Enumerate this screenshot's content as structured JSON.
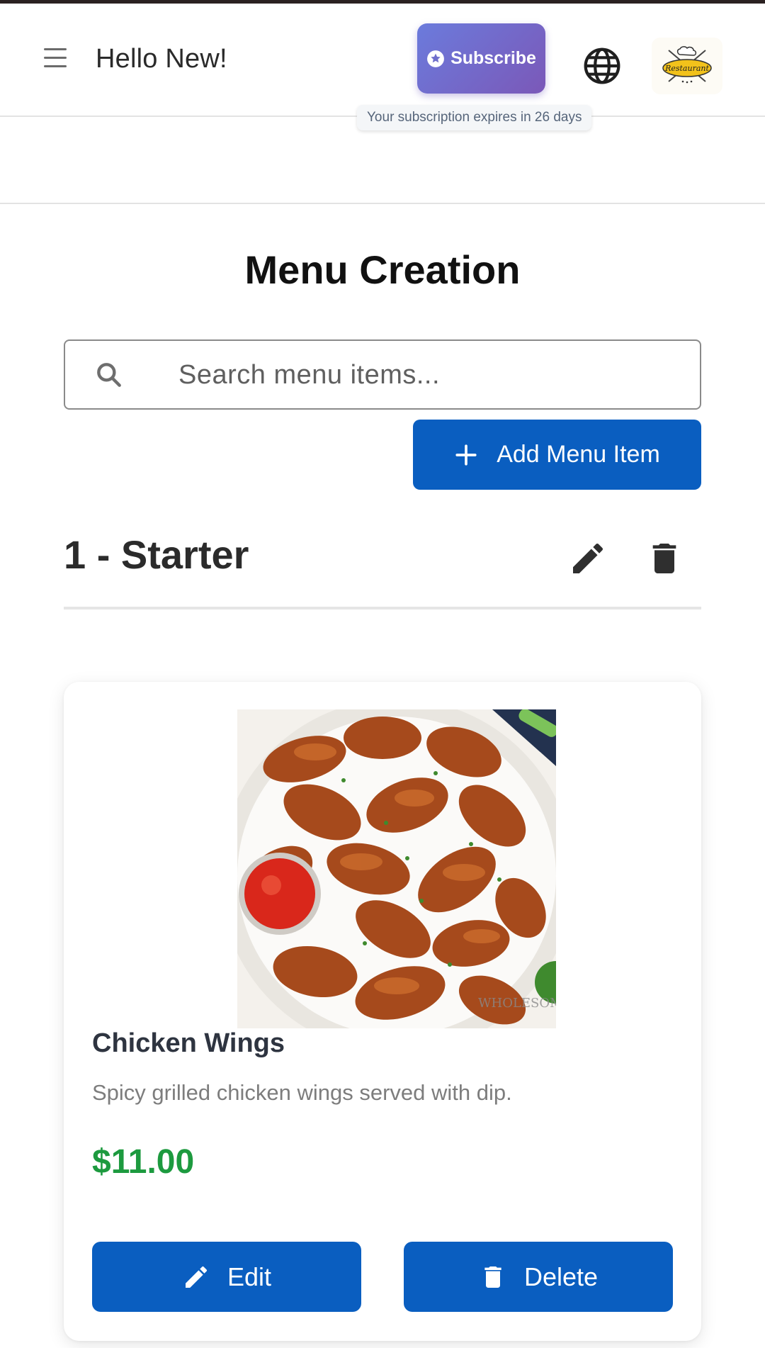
{
  "header": {
    "greeting": "Hello New!",
    "subscribe_label": "Subscribe",
    "subscription_notice": "Your subscription expires in 26 days",
    "menu_icon": "hamburger-menu-icon",
    "language_icon": "globe-icon",
    "logo_text": "Restaurant"
  },
  "main": {
    "title": "Menu Creation",
    "search": {
      "placeholder": "Search menu items..."
    },
    "add_button_label": "Add Menu Item"
  },
  "categories": [
    {
      "title": "1 - Starter",
      "items": [
        {
          "name": "Chicken Wings",
          "description": "Spicy grilled chicken wings served with dip.",
          "price": "$11.00",
          "edit_label": "Edit",
          "delete_label": "Delete"
        }
      ]
    }
  ],
  "colors": {
    "primary": "#0a5ec0",
    "price": "#1d9a3f",
    "subscribe_start": "#6b7bdc",
    "subscribe_end": "#7b58b8"
  }
}
